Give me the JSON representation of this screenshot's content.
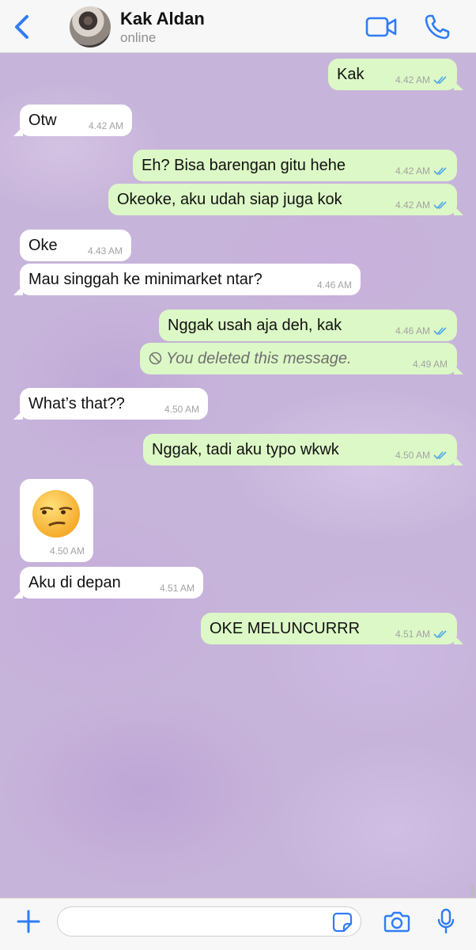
{
  "header": {
    "contact_name": "Kak Aldan",
    "status": "online"
  },
  "messages": [
    {
      "dir": "out",
      "text": "Kak",
      "time": "4.42 AM",
      "read": true
    },
    {
      "dir": "in",
      "text": "Otw",
      "time": "4.42 AM"
    },
    {
      "dir": "out",
      "text": "Eh? Bisa barengan gitu hehe",
      "time": "4.42 AM",
      "read": true
    },
    {
      "dir": "out",
      "text": "Okeoke, aku udah siap juga kok",
      "time": "4.42 AM",
      "read": true
    },
    {
      "dir": "in",
      "text": "Oke",
      "time": "4.43 AM"
    },
    {
      "dir": "in",
      "text": "Mau singgah ke minimarket ntar?",
      "time": "4.46 AM"
    },
    {
      "dir": "out",
      "text": "Nggak usah aja deh, kak",
      "time": "4.46 AM",
      "read": true
    },
    {
      "dir": "out",
      "text": "You deleted this message.",
      "time": "4.49 AM",
      "deleted": true
    },
    {
      "dir": "in",
      "text": "What’s that??",
      "time": "4.50 AM"
    },
    {
      "dir": "out",
      "text": "Nggak, tadi aku typo wkwk",
      "time": "4.50 AM",
      "read": true
    },
    {
      "dir": "in",
      "text": "😒",
      "time": "4.50 AM",
      "emoji": "unamused-face"
    },
    {
      "dir": "in",
      "text": "Aku di depan",
      "time": "4.51 AM"
    },
    {
      "dir": "out",
      "text": "OKE MELUNCURRR",
      "time": "4.51 AM",
      "read": true
    }
  ],
  "composer": {
    "placeholder": ""
  },
  "colors": {
    "accent": "#2f7cf6",
    "outgoing_bubble": "#dcf8c6",
    "incoming_bubble": "#ffffff",
    "read_ticks": "#4fa8e8",
    "wallpaper": "#c7b4da"
  },
  "icons": [
    "back-chevron-icon",
    "video-call-icon",
    "phone-icon",
    "plus-icon",
    "sticker-icon",
    "camera-icon",
    "microphone-icon",
    "read-ticks-icon",
    "deleted-ban-icon"
  ]
}
